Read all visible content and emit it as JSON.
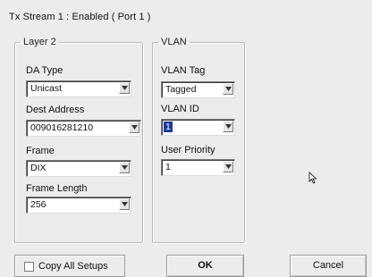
{
  "window": {
    "title": "Tx Stream 1 : Enabled  ( Port 1 )"
  },
  "layer2": {
    "legend": "Layer 2",
    "da_type": {
      "label": "DA Type",
      "value": "Unicast"
    },
    "dest_address": {
      "label": "Dest Address",
      "value": "009016281210"
    },
    "frame": {
      "label": "Frame",
      "value": "DIX"
    },
    "frame_length": {
      "label": "Frame Length",
      "value": "256"
    }
  },
  "vlan": {
    "legend": "VLAN",
    "vlan_tag": {
      "label": "VLAN Tag",
      "value": "Tagged"
    },
    "vlan_id": {
      "label": "VLAN ID",
      "value": "1"
    },
    "user_priority": {
      "label": "User Priority",
      "value": "1"
    }
  },
  "footer": {
    "copy_all_setups_label": "Copy All Setups",
    "copy_all_setups_checked": false,
    "ok_label": "OK",
    "cancel_label": "Cancel"
  },
  "icons": {
    "dropdown": "chevron-down-icon",
    "pointer": "mouse-pointer-icon"
  },
  "colors": {
    "background": "#ececea",
    "selection": "#1c3a9c"
  }
}
